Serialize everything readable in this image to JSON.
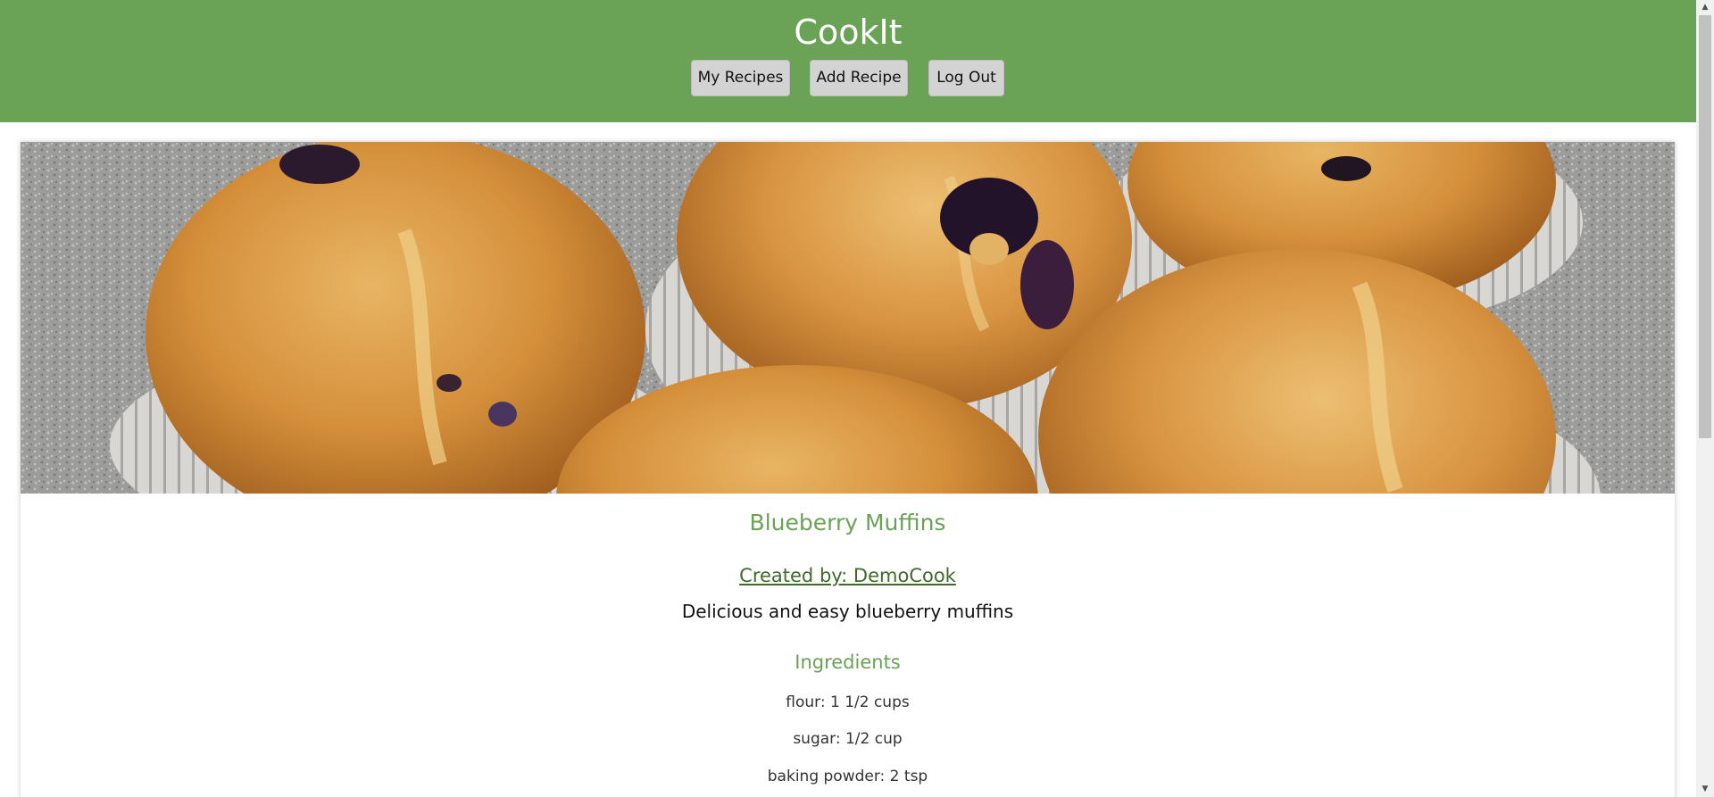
{
  "header": {
    "title": "CookIt",
    "nav": {
      "my_recipes": "My Recipes",
      "add_recipe": "Add Recipe",
      "log_out": "Log Out"
    }
  },
  "recipe": {
    "title": "Blueberry Muffins",
    "created_by": "Created by: DemoCook",
    "description": "Delicious and easy blueberry muffins",
    "ingredients_heading": "Ingredients",
    "ingredients": [
      "flour: 1 1/2 cups",
      "sugar: 1/2 cup",
      "baking powder: 2 tsp"
    ]
  },
  "colors": {
    "header_bg": "#6aa256",
    "accent": "#6aa256",
    "link": "#3f6a2a"
  },
  "icons": {
    "scroll_up": "scroll-up-arrow-icon",
    "scroll_down": "scroll-down-arrow-icon"
  }
}
